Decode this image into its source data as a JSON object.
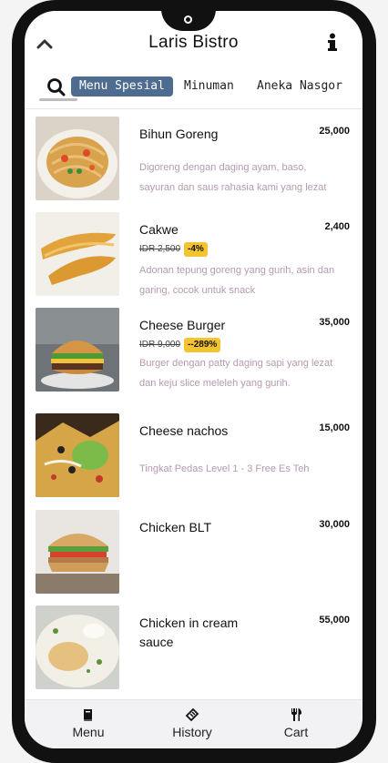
{
  "app": {
    "title": "Laris Bistro"
  },
  "icons": {
    "back": "chevron-up-icon",
    "info": "info-icon",
    "search": "search-icon"
  },
  "colors": {
    "active_tab": "#4d6c8f",
    "discount_badge": "#f4c430",
    "description": "#b59ab0"
  },
  "tabs": [
    {
      "label": "Menu Spesial",
      "active": true
    },
    {
      "label": "Minuman",
      "active": false
    },
    {
      "label": "Aneka Nasgor",
      "active": false
    }
  ],
  "menu": [
    {
      "name": "Bihun Goreng",
      "price": "25,000",
      "old_price": "",
      "discount": "",
      "description": "Digoreng dengan daging ayam, baso, sayuran dan saus rahasia kami yang lezat",
      "image": "fried-noodles"
    },
    {
      "name": "Cakwe",
      "price": "2,400",
      "old_price": "IDR 2,500",
      "discount": "-4%",
      "description": "Adonan tepung goreng yang gurih, asin dan garing, cocok untuk snack",
      "image": "cakwe"
    },
    {
      "name": "Cheese Burger",
      "price": "35,000",
      "old_price": "IDR 9,000",
      "discount": "--289%",
      "description": "Burger dengan patty daging sapi yang lezat dan keju slice meleleh yang gurih.",
      "image": "cheese-burger"
    },
    {
      "name": "Cheese nachos",
      "price": "15,000",
      "old_price": "",
      "discount": "",
      "description": "Tingkat Pedas Level 1 - 3 Free Es Teh",
      "image": "nachos"
    },
    {
      "name": "Chicken BLT",
      "price": "30,000",
      "old_price": "",
      "discount": "",
      "description": "",
      "image": "chicken-blt"
    },
    {
      "name": "Chicken in cream sauce",
      "price": "55,000",
      "old_price": "",
      "discount": "",
      "description": "",
      "image": "chicken-cream"
    }
  ],
  "bottom_nav": [
    {
      "label": "Menu",
      "icon": "book-icon"
    },
    {
      "label": "History",
      "icon": "receipt-icon"
    },
    {
      "label": "Cart",
      "icon": "cutlery-icon"
    }
  ]
}
